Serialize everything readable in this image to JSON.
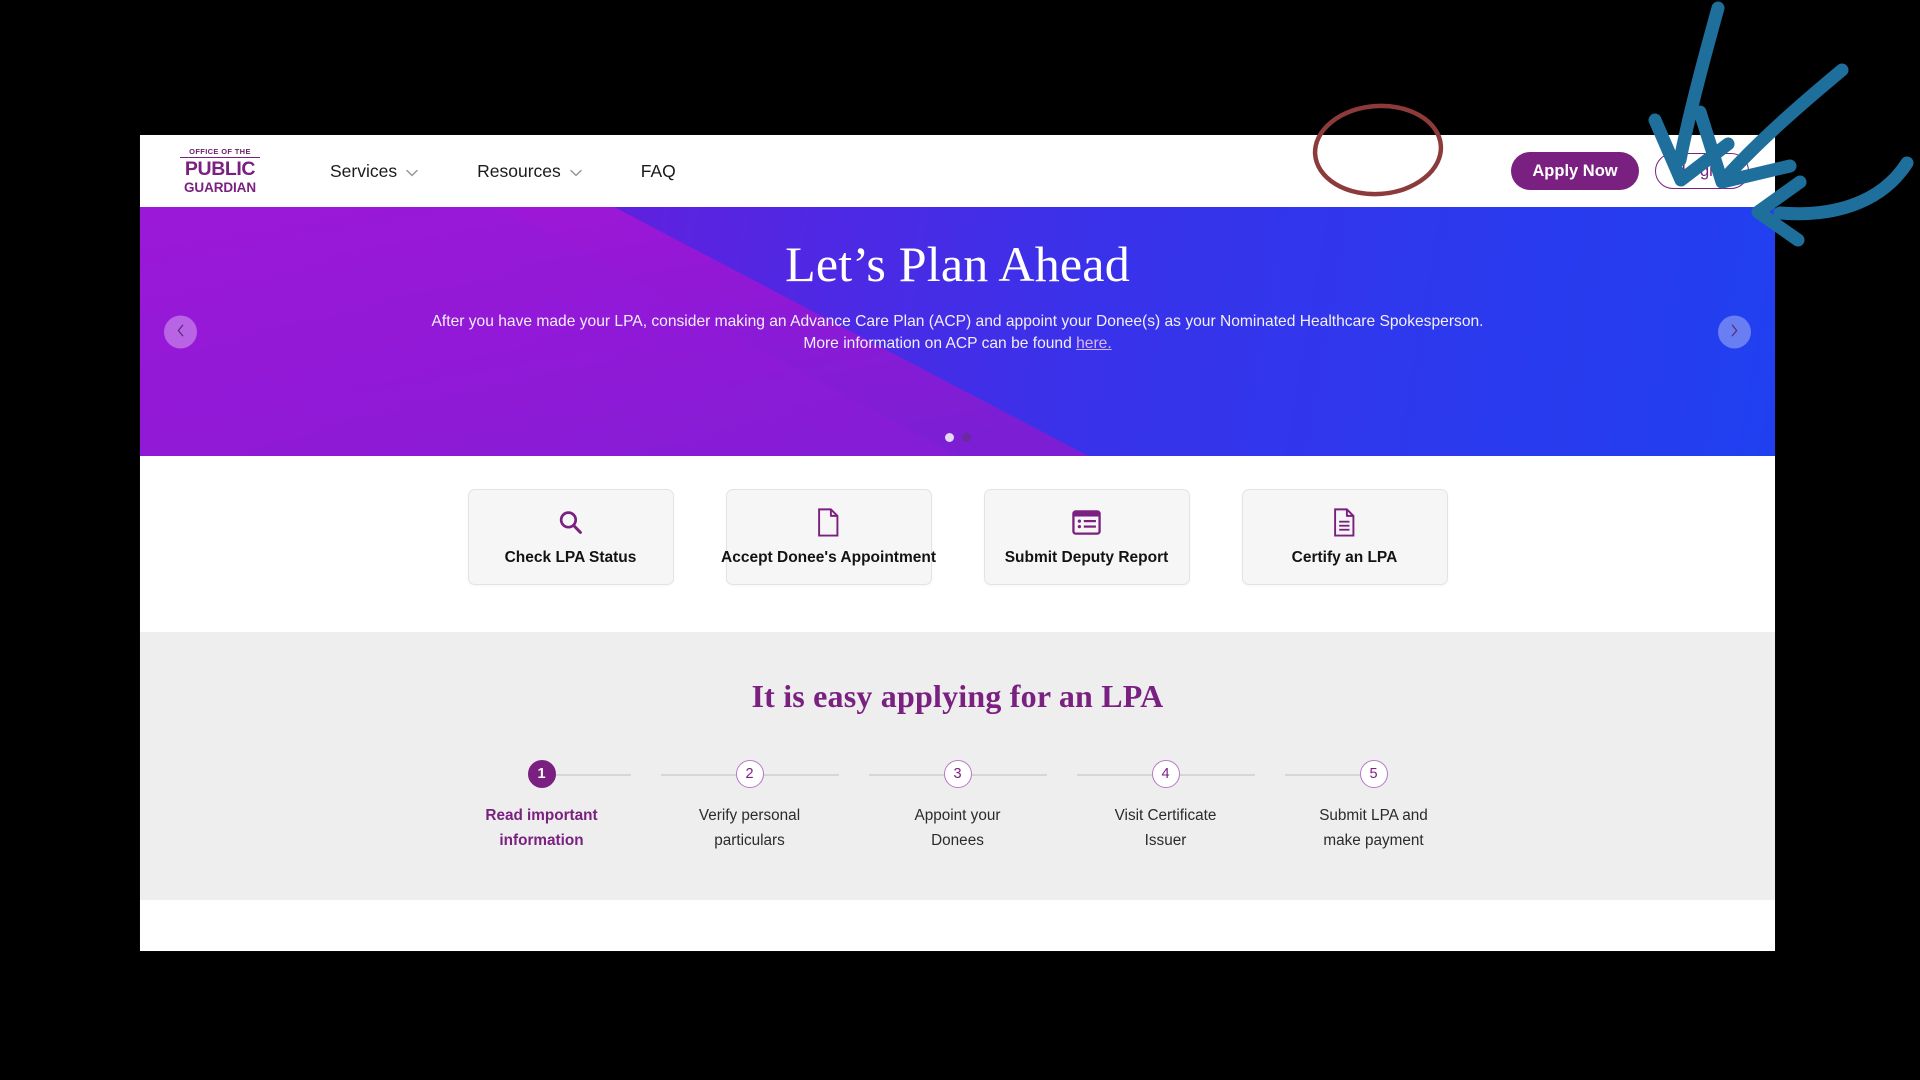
{
  "nav": {
    "logo": {
      "line1": "OFFICE OF THE",
      "line2": "PUBLIC",
      "line3": "GUARDIAN"
    },
    "links": [
      {
        "label": "Services",
        "has_caret": true,
        "icon": "chevron-down-icon"
      },
      {
        "label": "Resources",
        "has_caret": true,
        "icon": "chevron-down-icon"
      },
      {
        "label": "FAQ",
        "has_caret": false,
        "icon": ""
      }
    ],
    "apply_label": "Apply Now",
    "login_label": "Login"
  },
  "hero": {
    "title": "Let’s Plan Ahead",
    "subtitle_before": "After you have made your LPA, consider making an Advance Care Plan (ACP) and appoint your Donee(s) as your Nominated Healthcare Spokesperson. More information on ACP can be found ",
    "link_text": "here.",
    "prev_icon": "chevron-left-icon",
    "next_icon": "chevron-right-icon",
    "dots": [
      {
        "state": "active"
      },
      {
        "state": "inactive"
      }
    ]
  },
  "quick_cards": [
    {
      "label": "Check LPA Status",
      "icon": "search-icon"
    },
    {
      "label": "Accept Donee's Appointment",
      "icon": "document-blank-icon"
    },
    {
      "label": "Submit Deputy Report",
      "icon": "report-list-icon"
    },
    {
      "label": "Certify an LPA",
      "icon": "document-lines-icon"
    }
  ],
  "steps_section": {
    "title": "It is easy applying for an LPA",
    "steps": [
      {
        "number": "1",
        "line1": "Read important",
        "line2": "information",
        "state": "active"
      },
      {
        "number": "2",
        "line1": "Verify personal",
        "line2": "particulars",
        "state": "inactive"
      },
      {
        "number": "3",
        "line1": "Appoint your",
        "line2": "Donees",
        "state": "inactive"
      },
      {
        "number": "4",
        "line1": "Visit Certificate",
        "line2": "Issuer",
        "state": "inactive"
      },
      {
        "number": "5",
        "line1": "Submit LPA and",
        "line2": "make payment",
        "state": "inactive"
      }
    ]
  },
  "annotations": {
    "highlight_target": "login-button",
    "ellipse_color": "#8c3a3a",
    "arrow_color": "#1f6f9c",
    "arrow_count": 3
  },
  "colors": {
    "brand_purple": "#7a2080",
    "hero_purple": "#9019d2",
    "hero_blue": "#2040f0",
    "card_bg": "#f6f6f6",
    "band_bg": "#eeeeee"
  }
}
